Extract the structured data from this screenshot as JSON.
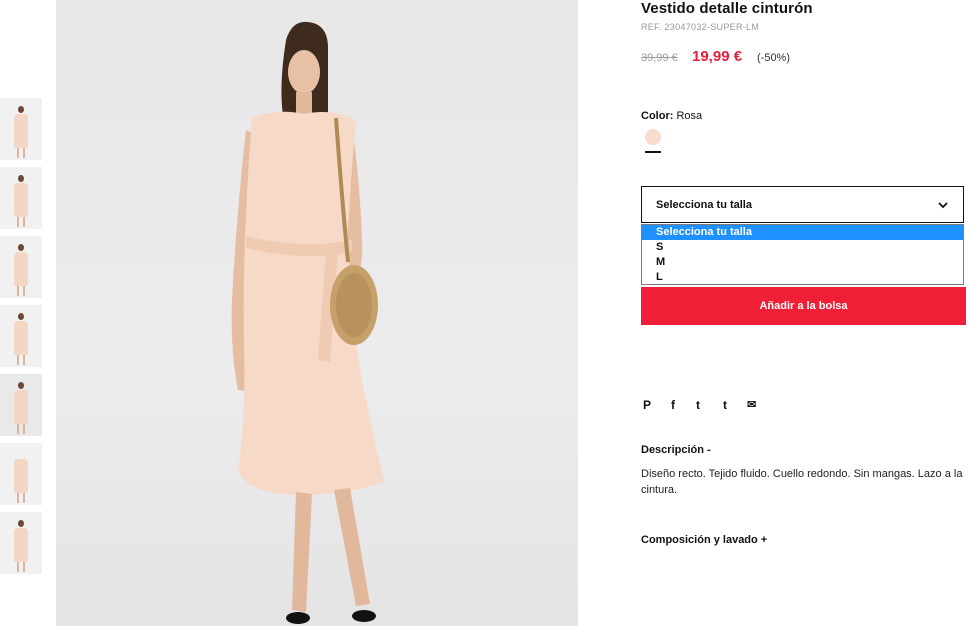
{
  "product": {
    "title": "Vestido detalle cinturón",
    "ref": "REF. 23047032-SUPER-LM",
    "old_price": "39,99 €",
    "new_price": "19,99 €",
    "discount": "(-50%)"
  },
  "color": {
    "label": "Color:",
    "value": "Rosa",
    "swatch_hex": "#f8dccd"
  },
  "size": {
    "select_label": "Selecciona tu talla",
    "options": [
      "Selecciona tu talla",
      "S",
      "M",
      "L"
    ],
    "selected_index": 0
  },
  "cart": {
    "add_label": "Añadir a la bolsa"
  },
  "share": {
    "pinterest": "P",
    "facebook": "f",
    "twitter": "t",
    "tumblr": "t",
    "email": "✉"
  },
  "description": {
    "heading": "Descripción -",
    "text": "Diseño recto. Tejido fluido. Cuello redondo. Sin mangas. Lazo a la cintura."
  },
  "composition": {
    "heading": "Composición y lavado +"
  },
  "colors": {
    "accent": "#e3203b",
    "button": "#ee1f36",
    "dropdown_highlight": "#1e90ff"
  },
  "thumbnails_count": 7
}
